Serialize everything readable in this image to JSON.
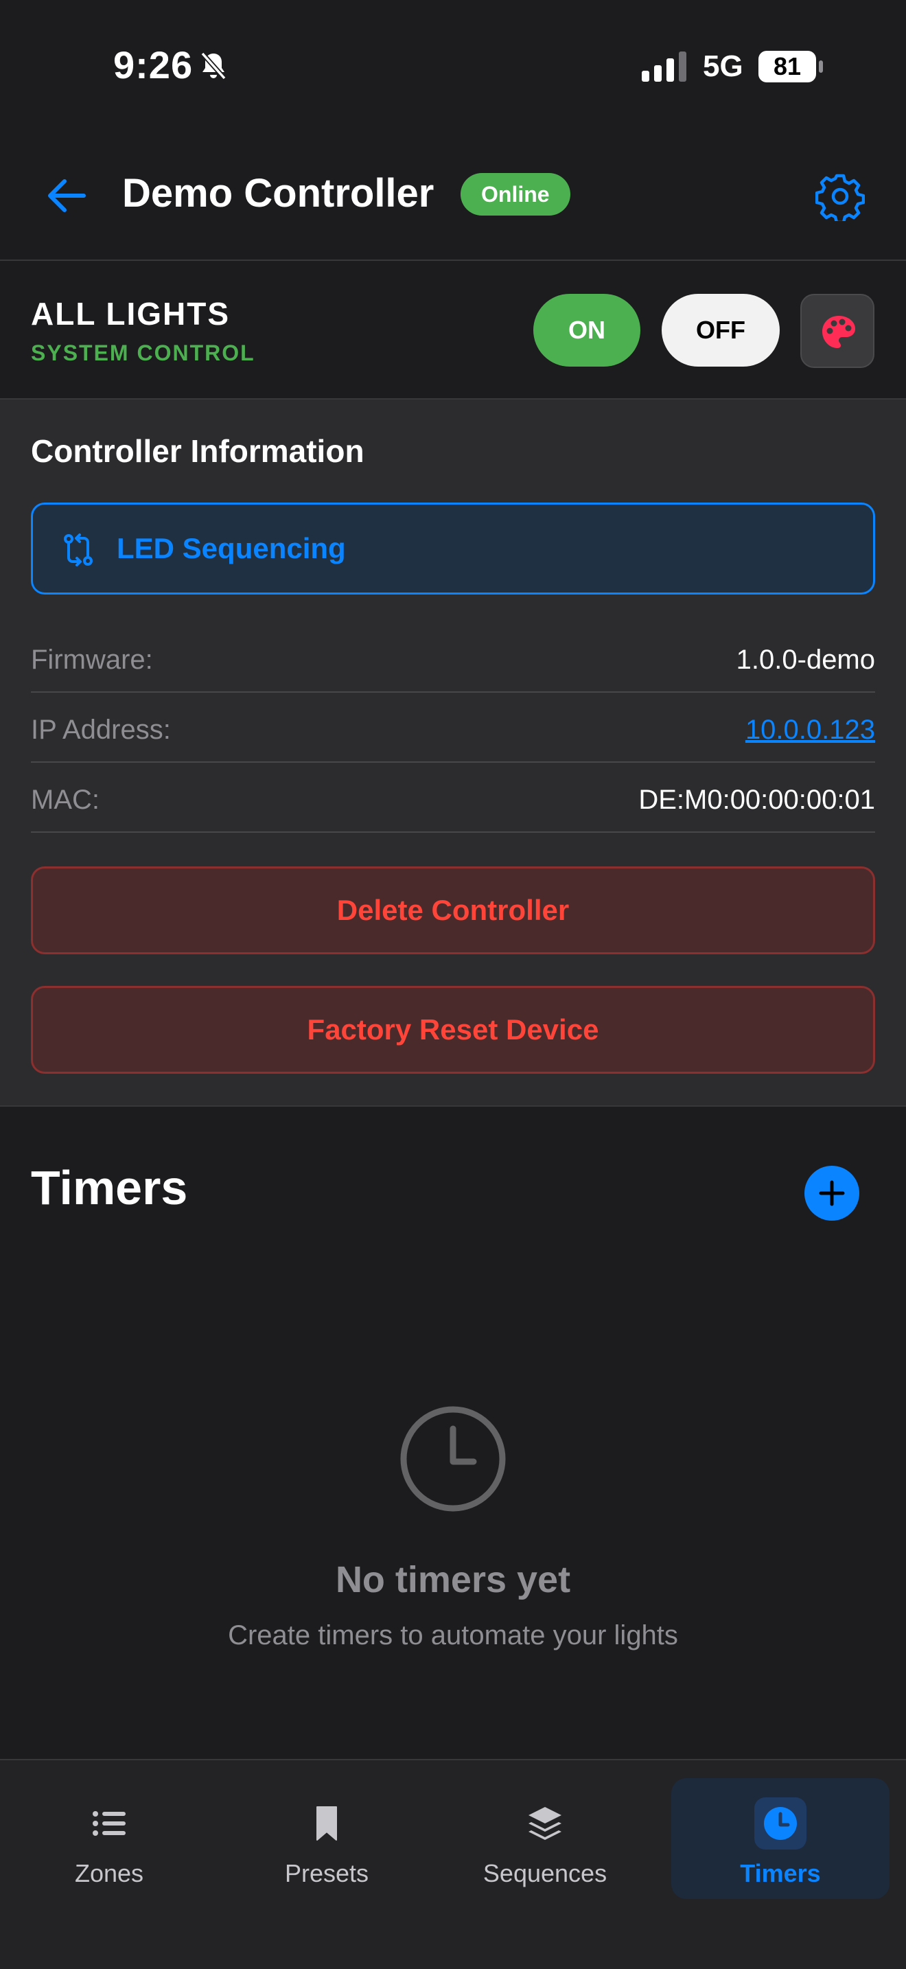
{
  "status_bar": {
    "time": "9:26",
    "network": "5G",
    "battery": "81"
  },
  "header": {
    "title": "Demo Controller",
    "status_badge": "Online"
  },
  "all_lights": {
    "title": "ALL LIGHTS",
    "subtitle": "SYSTEM CONTROL",
    "on_label": "ON",
    "off_label": "OFF"
  },
  "controller_info": {
    "title": "Controller Information",
    "sequencing_label": "LED Sequencing",
    "rows": [
      {
        "key": "Firmware:",
        "value": "1.0.0-demo"
      },
      {
        "key": "IP Address:",
        "value": "10.0.0.123"
      },
      {
        "key": "MAC:",
        "value": "DE:M0:00:00:00:01"
      }
    ],
    "delete_label": "Delete Controller",
    "reset_label": "Factory Reset Device"
  },
  "timers": {
    "title": "Timers",
    "empty_title": "No timers yet",
    "empty_subtitle": "Create timers to automate your lights"
  },
  "tabs": [
    {
      "label": "Zones",
      "icon": "list-icon"
    },
    {
      "label": "Presets",
      "icon": "bookmark-icon"
    },
    {
      "label": "Sequences",
      "icon": "layers-icon"
    },
    {
      "label": "Timers",
      "icon": "clock-icon",
      "active": true
    }
  ],
  "colors": {
    "accent": "#0a84ff",
    "online": "#4caf50",
    "danger": "#ff453a",
    "background": "#1c1c1e",
    "card": "#2c2c2e"
  }
}
